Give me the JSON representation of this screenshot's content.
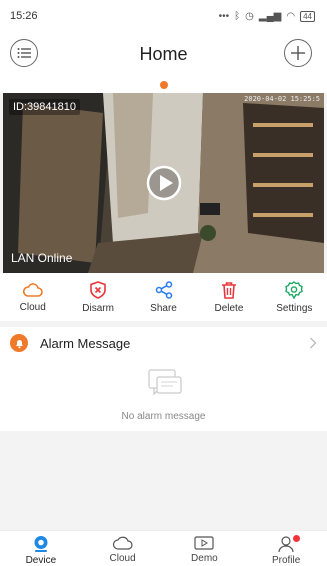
{
  "status_bar": {
    "time": "15:26",
    "battery": "44"
  },
  "header": {
    "title": "Home"
  },
  "camera": {
    "id_label": "ID:39841810",
    "timestamp": "2020-04-02 15:25:5",
    "status": "LAN Online"
  },
  "actions": [
    {
      "label": "Cloud",
      "color": "#f07a2a",
      "icon": "cloud-icon"
    },
    {
      "label": "Disarm",
      "color": "#e8383d",
      "icon": "shield-x-icon"
    },
    {
      "label": "Share",
      "color": "#2a7cf0",
      "icon": "share-icon"
    },
    {
      "label": "Delete",
      "color": "#e8383d",
      "icon": "trash-icon"
    },
    {
      "label": "Settings",
      "color": "#1aa860",
      "icon": "gear-icon"
    }
  ],
  "alarm": {
    "title": "Alarm Message",
    "empty_text": "No alarm message"
  },
  "bottom_nav": [
    {
      "label": "Device",
      "icon": "camera-icon",
      "active": true
    },
    {
      "label": "Cloud",
      "icon": "cloud-icon"
    },
    {
      "label": "Demo",
      "icon": "play-box-icon"
    },
    {
      "label": "Profile",
      "icon": "person-icon",
      "badge": true
    }
  ],
  "colors": {
    "accent": "#f07a2a",
    "active_nav": "#1e88e5"
  }
}
